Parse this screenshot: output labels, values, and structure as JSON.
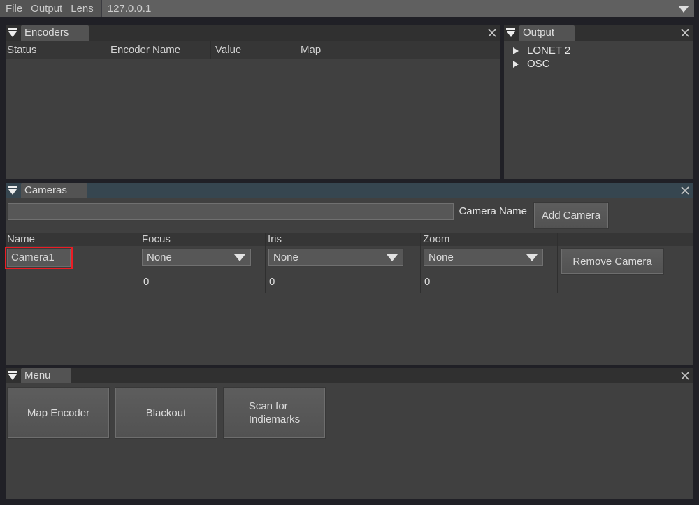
{
  "menubar": {
    "items": [
      "File",
      "Output",
      "Lens"
    ],
    "address": "127.0.0.1"
  },
  "encoders": {
    "title": "Encoders",
    "columns": [
      "Status",
      "Encoder Name",
      "Value",
      "Map"
    ]
  },
  "output": {
    "title": "Output",
    "items": [
      "LONET 2",
      "OSC"
    ]
  },
  "cameras": {
    "title": "Cameras",
    "name_input_value": "",
    "name_label": "Camera Name",
    "add_button": "Add Camera",
    "remove_button": "Remove Camera",
    "columns": [
      "Name",
      "Focus",
      "Iris",
      "Zoom"
    ],
    "row": {
      "name": "Camera1",
      "focus": "None",
      "iris": "None",
      "zoom": "None",
      "focus_value": "0",
      "iris_value": "0",
      "zoom_value": "0"
    }
  },
  "menu": {
    "title": "Menu",
    "buttons": [
      "Map Encoder",
      "Blackout",
      "Scan for\nIndiemarks"
    ]
  },
  "colors": {
    "highlight_red": "#ec1c24",
    "active_panel_header": "#364650",
    "menubar_bg": "#606060"
  }
}
